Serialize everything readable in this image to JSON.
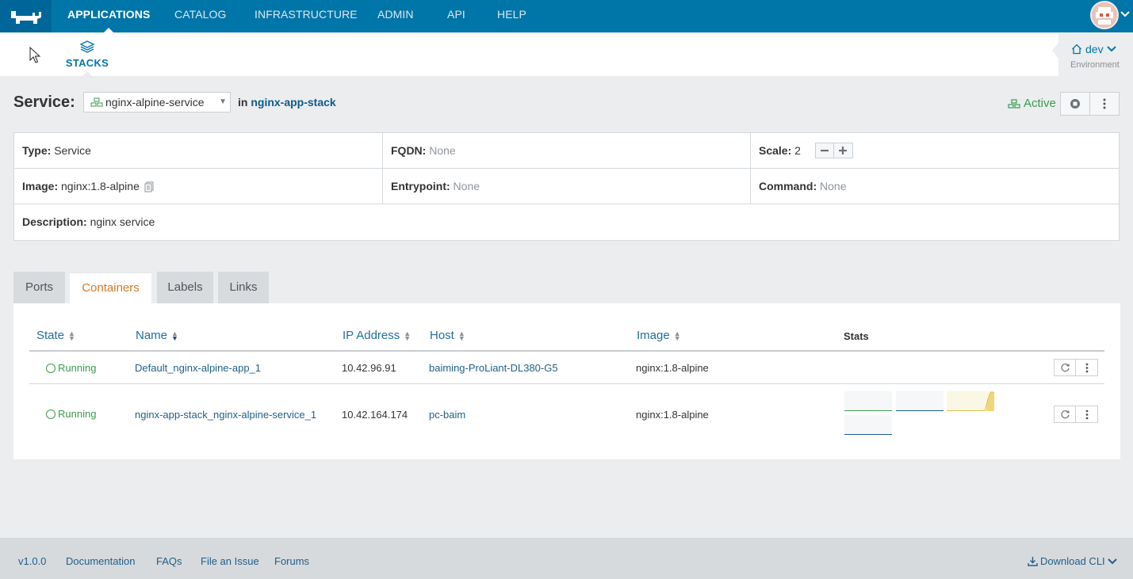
{
  "topnav": {
    "items": [
      {
        "label": "APPLICATIONS",
        "active": true
      },
      {
        "label": "CATALOG"
      },
      {
        "label": "INFRASTRUCTURE"
      },
      {
        "label": "ADMIN"
      },
      {
        "label": "API"
      },
      {
        "label": "HELP"
      }
    ]
  },
  "subnav": {
    "stacks_label": "STACKS"
  },
  "environment": {
    "name": "dev",
    "label": "Environment"
  },
  "service": {
    "title": "Service:",
    "selected": "nginx-alpine-service",
    "in_label": "in",
    "stack_name": "nginx-app-stack",
    "status": "Active"
  },
  "info": {
    "type_key": "Type:",
    "type_val": "Service",
    "fqdn_key": "FQDN:",
    "fqdn_val": "None",
    "scale_key": "Scale:",
    "scale_val": "2",
    "image_key": "Image:",
    "image_val": "nginx:1.8-alpine",
    "entry_key": "Entrypoint:",
    "entry_val": "None",
    "command_key": "Command:",
    "command_val": "None",
    "desc_key": "Description:",
    "desc_val": "nginx service"
  },
  "tabs": [
    {
      "label": "Ports"
    },
    {
      "label": "Containers",
      "active": true
    },
    {
      "label": "Labels"
    },
    {
      "label": "Links"
    }
  ],
  "table": {
    "headers": {
      "state": "State",
      "name": "Name",
      "ip": "IP Address",
      "host": "Host",
      "image": "Image",
      "stats": "Stats"
    },
    "rows": [
      {
        "state": "Running",
        "name": "Default_nginx-alpine-app_1",
        "ip": "10.42.96.91",
        "host": "baiming-ProLiant-DL380-G5",
        "image": "nginx:1.8-alpine"
      },
      {
        "state": "Running",
        "name": "nginx-app-stack_nginx-alpine-service_1",
        "ip": "10.42.164.174",
        "host": "pc-baim",
        "image": "nginx:1.8-alpine"
      }
    ]
  },
  "colors": {
    "primary": "#0075a8",
    "success": "#3a9b4d",
    "active_tab": "#d57a24"
  },
  "footer": {
    "version": "v1.0.0",
    "links": [
      "Documentation",
      "FAQs",
      "File an Issue",
      "Forums"
    ],
    "download": "Download CLI"
  }
}
